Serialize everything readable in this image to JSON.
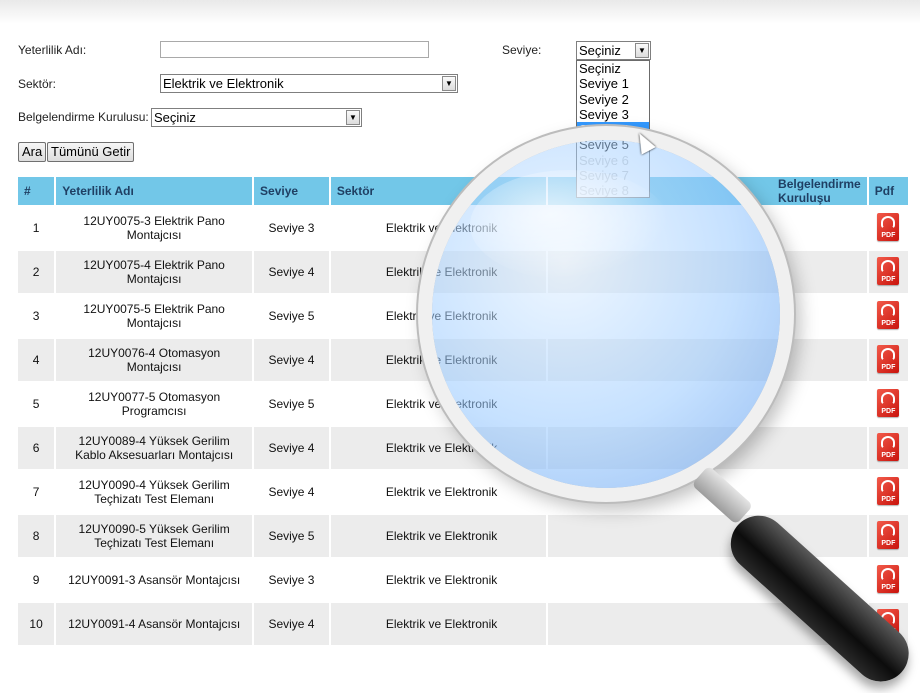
{
  "form": {
    "name_label": "Yeterlilik Adı:",
    "name_value": "",
    "sector_label": "Sektör:",
    "sector_value": "Elektrik ve Elektronik",
    "org_label": "Belgelendirme Kurulusu:",
    "org_value": "Seçiniz",
    "level_label": "Seviye:",
    "level_value": "Seçiniz",
    "search_button": "Ara",
    "all_button": "Tümünü Getir"
  },
  "level_dropdown": {
    "options": [
      "Seçiniz",
      "Seviye 1",
      "Seviye 2",
      "Seviye 3",
      "Seviye 4",
      "Seviye 5",
      "Seviye 6",
      "Seviye 7",
      "Seviye 8"
    ],
    "highlighted": "Seviye 4"
  },
  "table": {
    "headers": [
      "#",
      "Yeterlilik Adı",
      "Seviye",
      "Sektör",
      "Belgelendirme Kuruluşu",
      "Pdf"
    ],
    "pdf_label": "PDF",
    "rows": [
      {
        "num": "1",
        "name": "12UY0075-3 Elektrik Pano Montajcısı",
        "level": "Seviye 3",
        "sector": "Elektrik ve Elektronik"
      },
      {
        "num": "2",
        "name": "12UY0075-4 Elektrik Pano Montajcısı",
        "level": "Seviye 4",
        "sector": "Elektrik ve Elektronik"
      },
      {
        "num": "3",
        "name": "12UY0075-5 Elektrik Pano Montajcısı",
        "level": "Seviye 5",
        "sector": "Elektrik ve Elektronik"
      },
      {
        "num": "4",
        "name": "12UY0076-4 Otomasyon Montajcısı",
        "level": "Seviye 4",
        "sector": "Elektrik ve Elektronik"
      },
      {
        "num": "5",
        "name": "12UY0077-5 Otomasyon Programcısı",
        "level": "Seviye 5",
        "sector": "Elektrik ve Elektronik"
      },
      {
        "num": "6",
        "name": "12UY0089-4 Yüksek Gerilim Kablo Aksesuarları Montajcısı",
        "level": "Seviye 4",
        "sector": "Elektrik ve Elektronik"
      },
      {
        "num": "7",
        "name": "12UY0090-4 Yüksek Gerilim Teçhizatı Test Elemanı",
        "level": "Seviye 4",
        "sector": "Elektrik ve Elektronik"
      },
      {
        "num": "8",
        "name": "12UY0090-5 Yüksek Gerilim Teçhizatı Test Elemanı",
        "level": "Seviye 5",
        "sector": "Elektrik ve Elektronik"
      },
      {
        "num": "9",
        "name": "12UY0091-3 Asansör Montajcısı",
        "level": "Seviye 3",
        "sector": "Elektrik ve Elektronik"
      },
      {
        "num": "10",
        "name": "12UY0091-4 Asansör Montajcısı",
        "level": "Seviye 4",
        "sector": "Elektrik ve Elektronik"
      }
    ]
  },
  "colors": {
    "header_bg": "#72c7e8",
    "header_text": "#1f3f63",
    "row_alt": "#ececec",
    "dropdown_highlight": "#3399ff",
    "pdf_red": "#d4201a"
  }
}
